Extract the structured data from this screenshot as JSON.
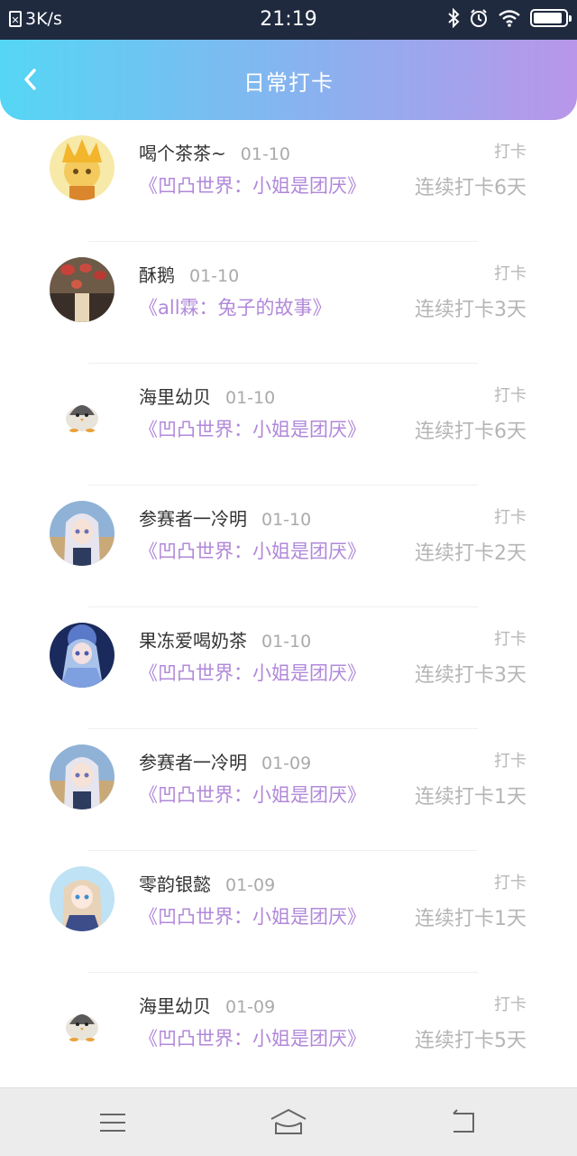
{
  "status_bar": {
    "network_speed": "3K/s",
    "time": "21:19",
    "icons": [
      "bluetooth-icon",
      "alarm-icon",
      "wifi-icon",
      "battery-icon"
    ],
    "battery_level": 0.9
  },
  "header": {
    "title": "日常打卡",
    "back_icon": "chevron-left-icon"
  },
  "checkins": [
    {
      "user": "喝个茶茶~",
      "date": "01-10",
      "action": "打卡",
      "book": "《凹凸世界：小姐是团厌》",
      "streak": "连续打卡6天",
      "avatar": "yellow-anime-avatar"
    },
    {
      "user": "酥鹅",
      "date": "01-10",
      "action": "打卡",
      "book": "《all霖：兔子的故事》",
      "streak": "连续打卡3天",
      "avatar": "lanterns-avatar"
    },
    {
      "user": "海里幼贝",
      "date": "01-10",
      "action": "打卡",
      "book": "《凹凸世界：小姐是团厌》",
      "streak": "连续打卡6天",
      "avatar": "penguin-avatar"
    },
    {
      "user": "参赛者一冷明",
      "date": "01-10",
      "action": "打卡",
      "book": "《凹凸世界：小姐是团厌》",
      "streak": "连续打卡2天",
      "avatar": "silver-hair-girl-avatar"
    },
    {
      "user": "果冻爱喝奶茶",
      "date": "01-10",
      "action": "打卡",
      "book": "《凹凸世界：小姐是团厌》",
      "streak": "连续打卡3天",
      "avatar": "blue-lolita-avatar"
    },
    {
      "user": "参赛者一冷明",
      "date": "01-09",
      "action": "打卡",
      "book": "《凹凸世界：小姐是团厌》",
      "streak": "连续打卡1天",
      "avatar": "silver-hair-girl-avatar"
    },
    {
      "user": "零韵银懿",
      "date": "01-09",
      "action": "打卡",
      "book": "《凹凸世界：小姐是团厌》",
      "streak": "连续打卡1天",
      "avatar": "light-hair-girl-avatar"
    },
    {
      "user": "海里幼贝",
      "date": "01-09",
      "action": "打卡",
      "book": "《凹凸世界：小姐是团厌》",
      "streak": "连续打卡5天",
      "avatar": "penguin-avatar"
    }
  ],
  "nav_bar": {
    "icons": [
      "menu-icon",
      "home-icon",
      "back-icon"
    ]
  }
}
